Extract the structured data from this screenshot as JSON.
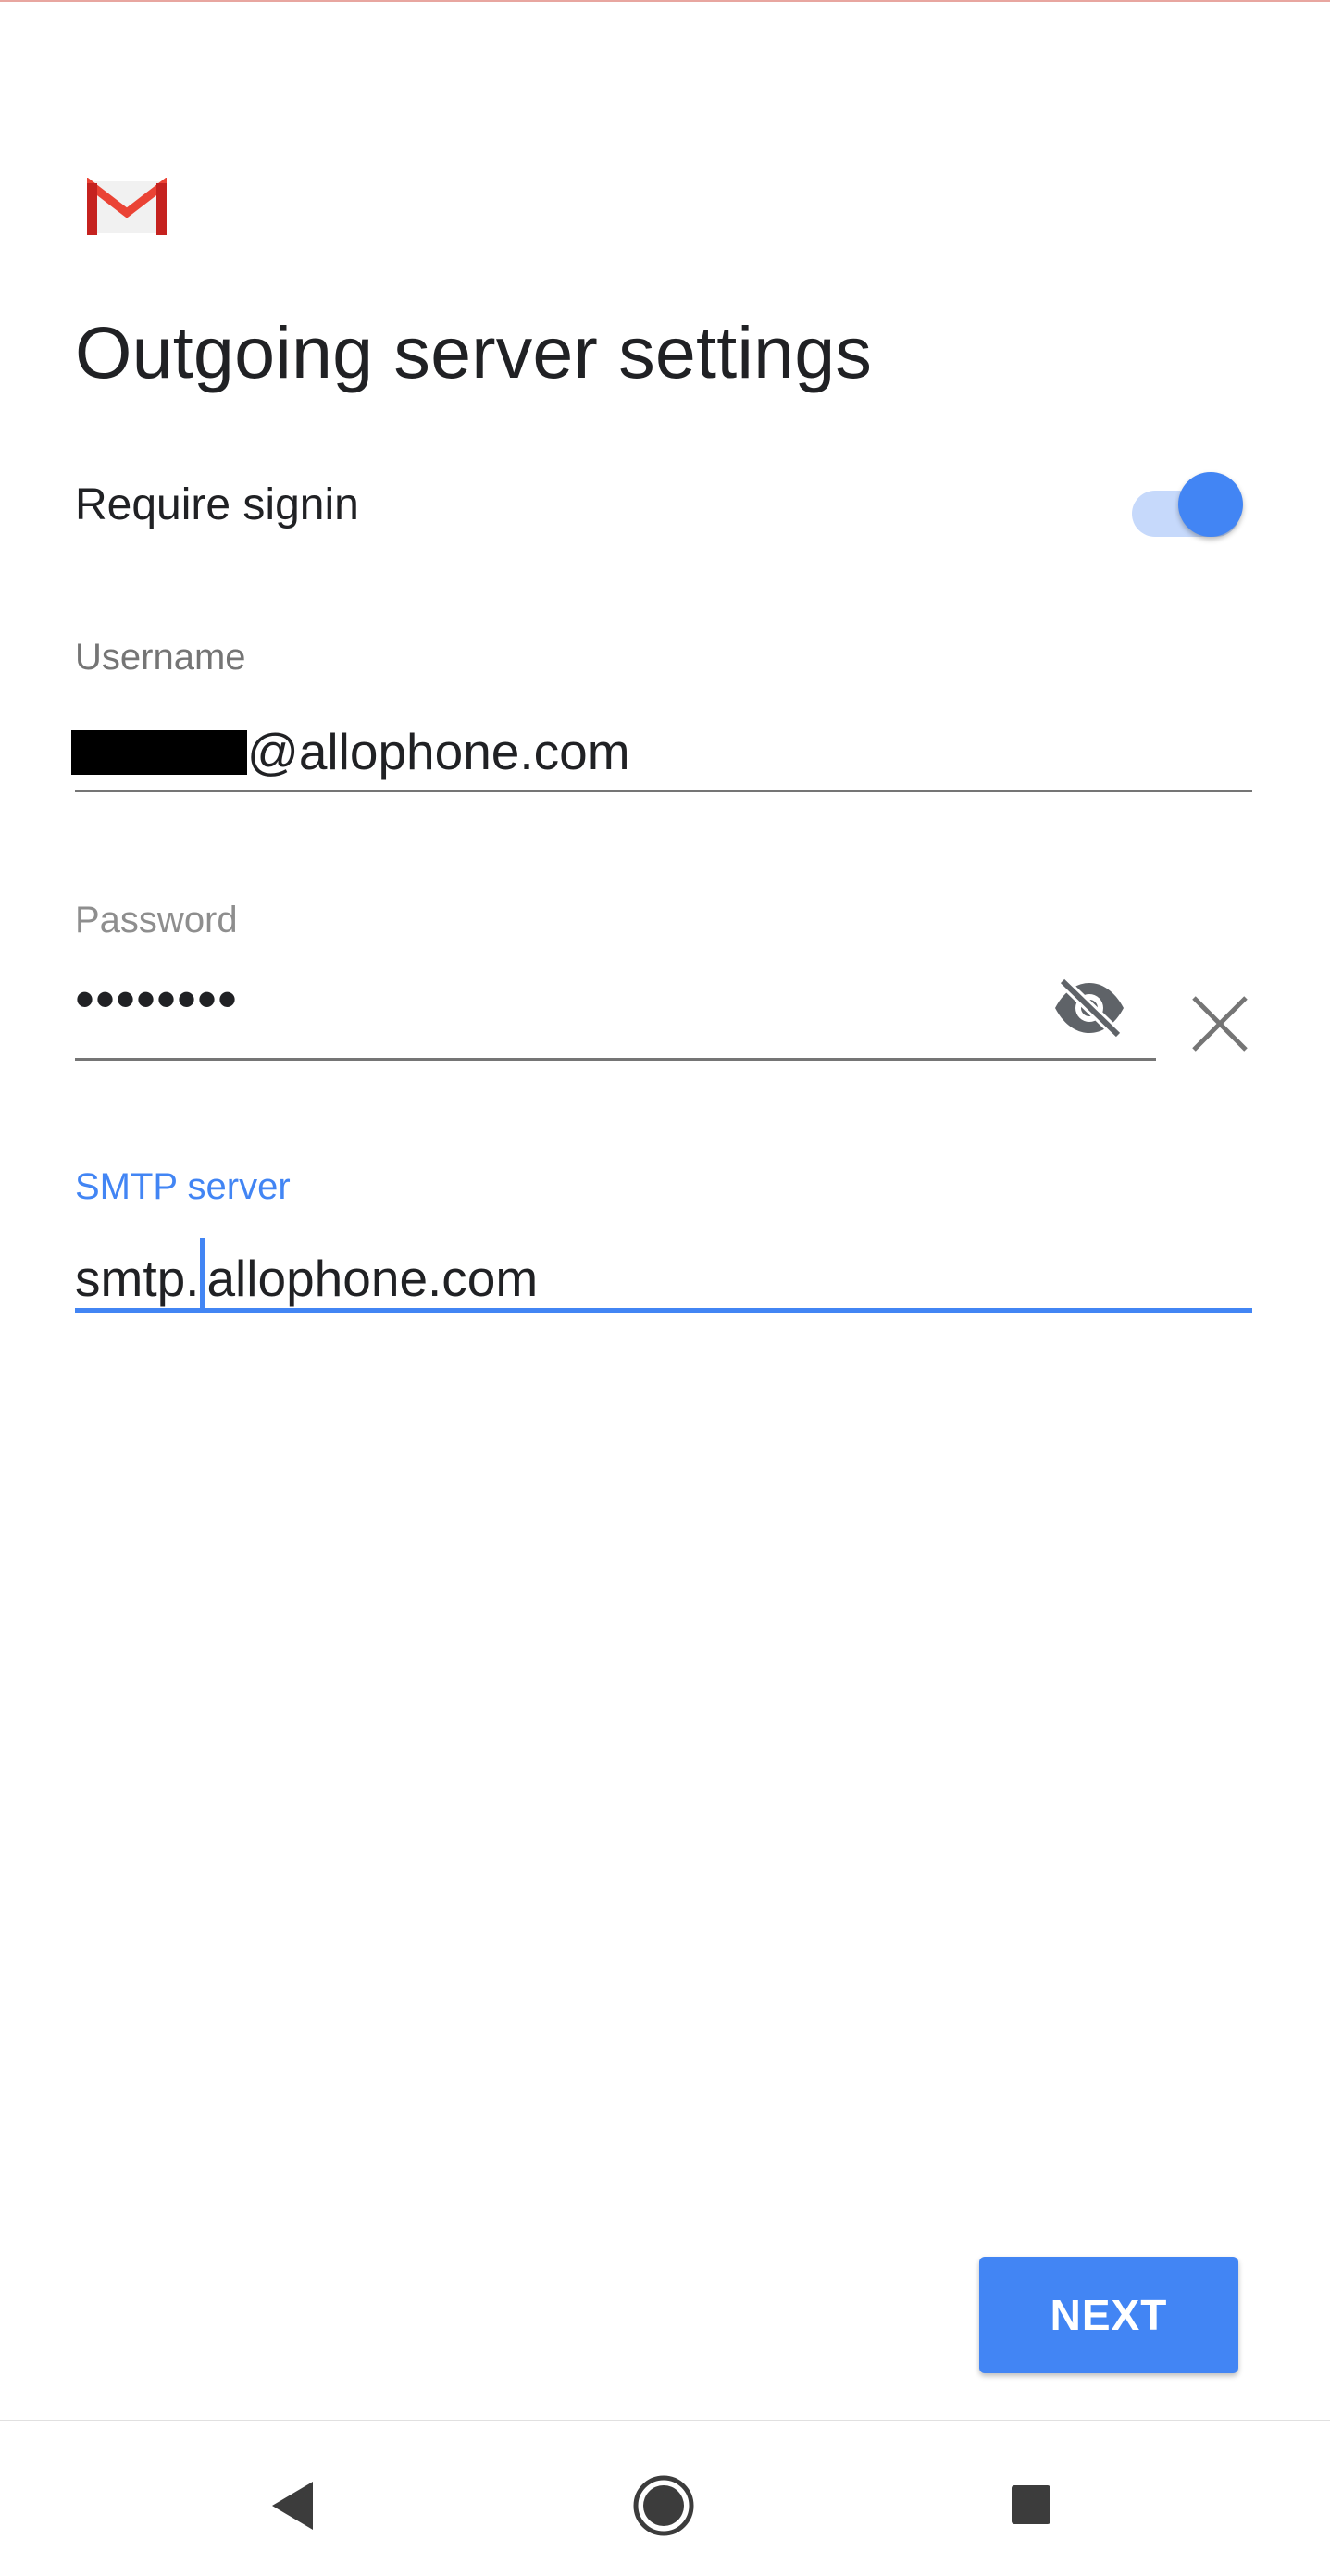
{
  "header": {
    "title": "Outgoing server settings"
  },
  "require_signin": {
    "label": "Require signin",
    "enabled": true
  },
  "username": {
    "label": "Username",
    "value_suffix": "@allophone.com"
  },
  "password": {
    "label": "Password",
    "masked_value": "••••••••"
  },
  "smtp_server": {
    "label": "SMTP server",
    "value_before_cursor": "smtp.",
    "value_after_cursor": "allophone.com"
  },
  "actions": {
    "next_label": "NEXT"
  },
  "colors": {
    "accent": "#4285f4",
    "gmail_red": "#ea4335",
    "text": "#202124",
    "label_gray": "#757575"
  },
  "icons": {
    "logo": "gmail-logo-icon",
    "password_visibility": "eye-off-icon",
    "clear": "close-icon",
    "nav_back": "nav-back-icon",
    "nav_home": "nav-home-icon",
    "nav_recents": "nav-recents-icon"
  }
}
